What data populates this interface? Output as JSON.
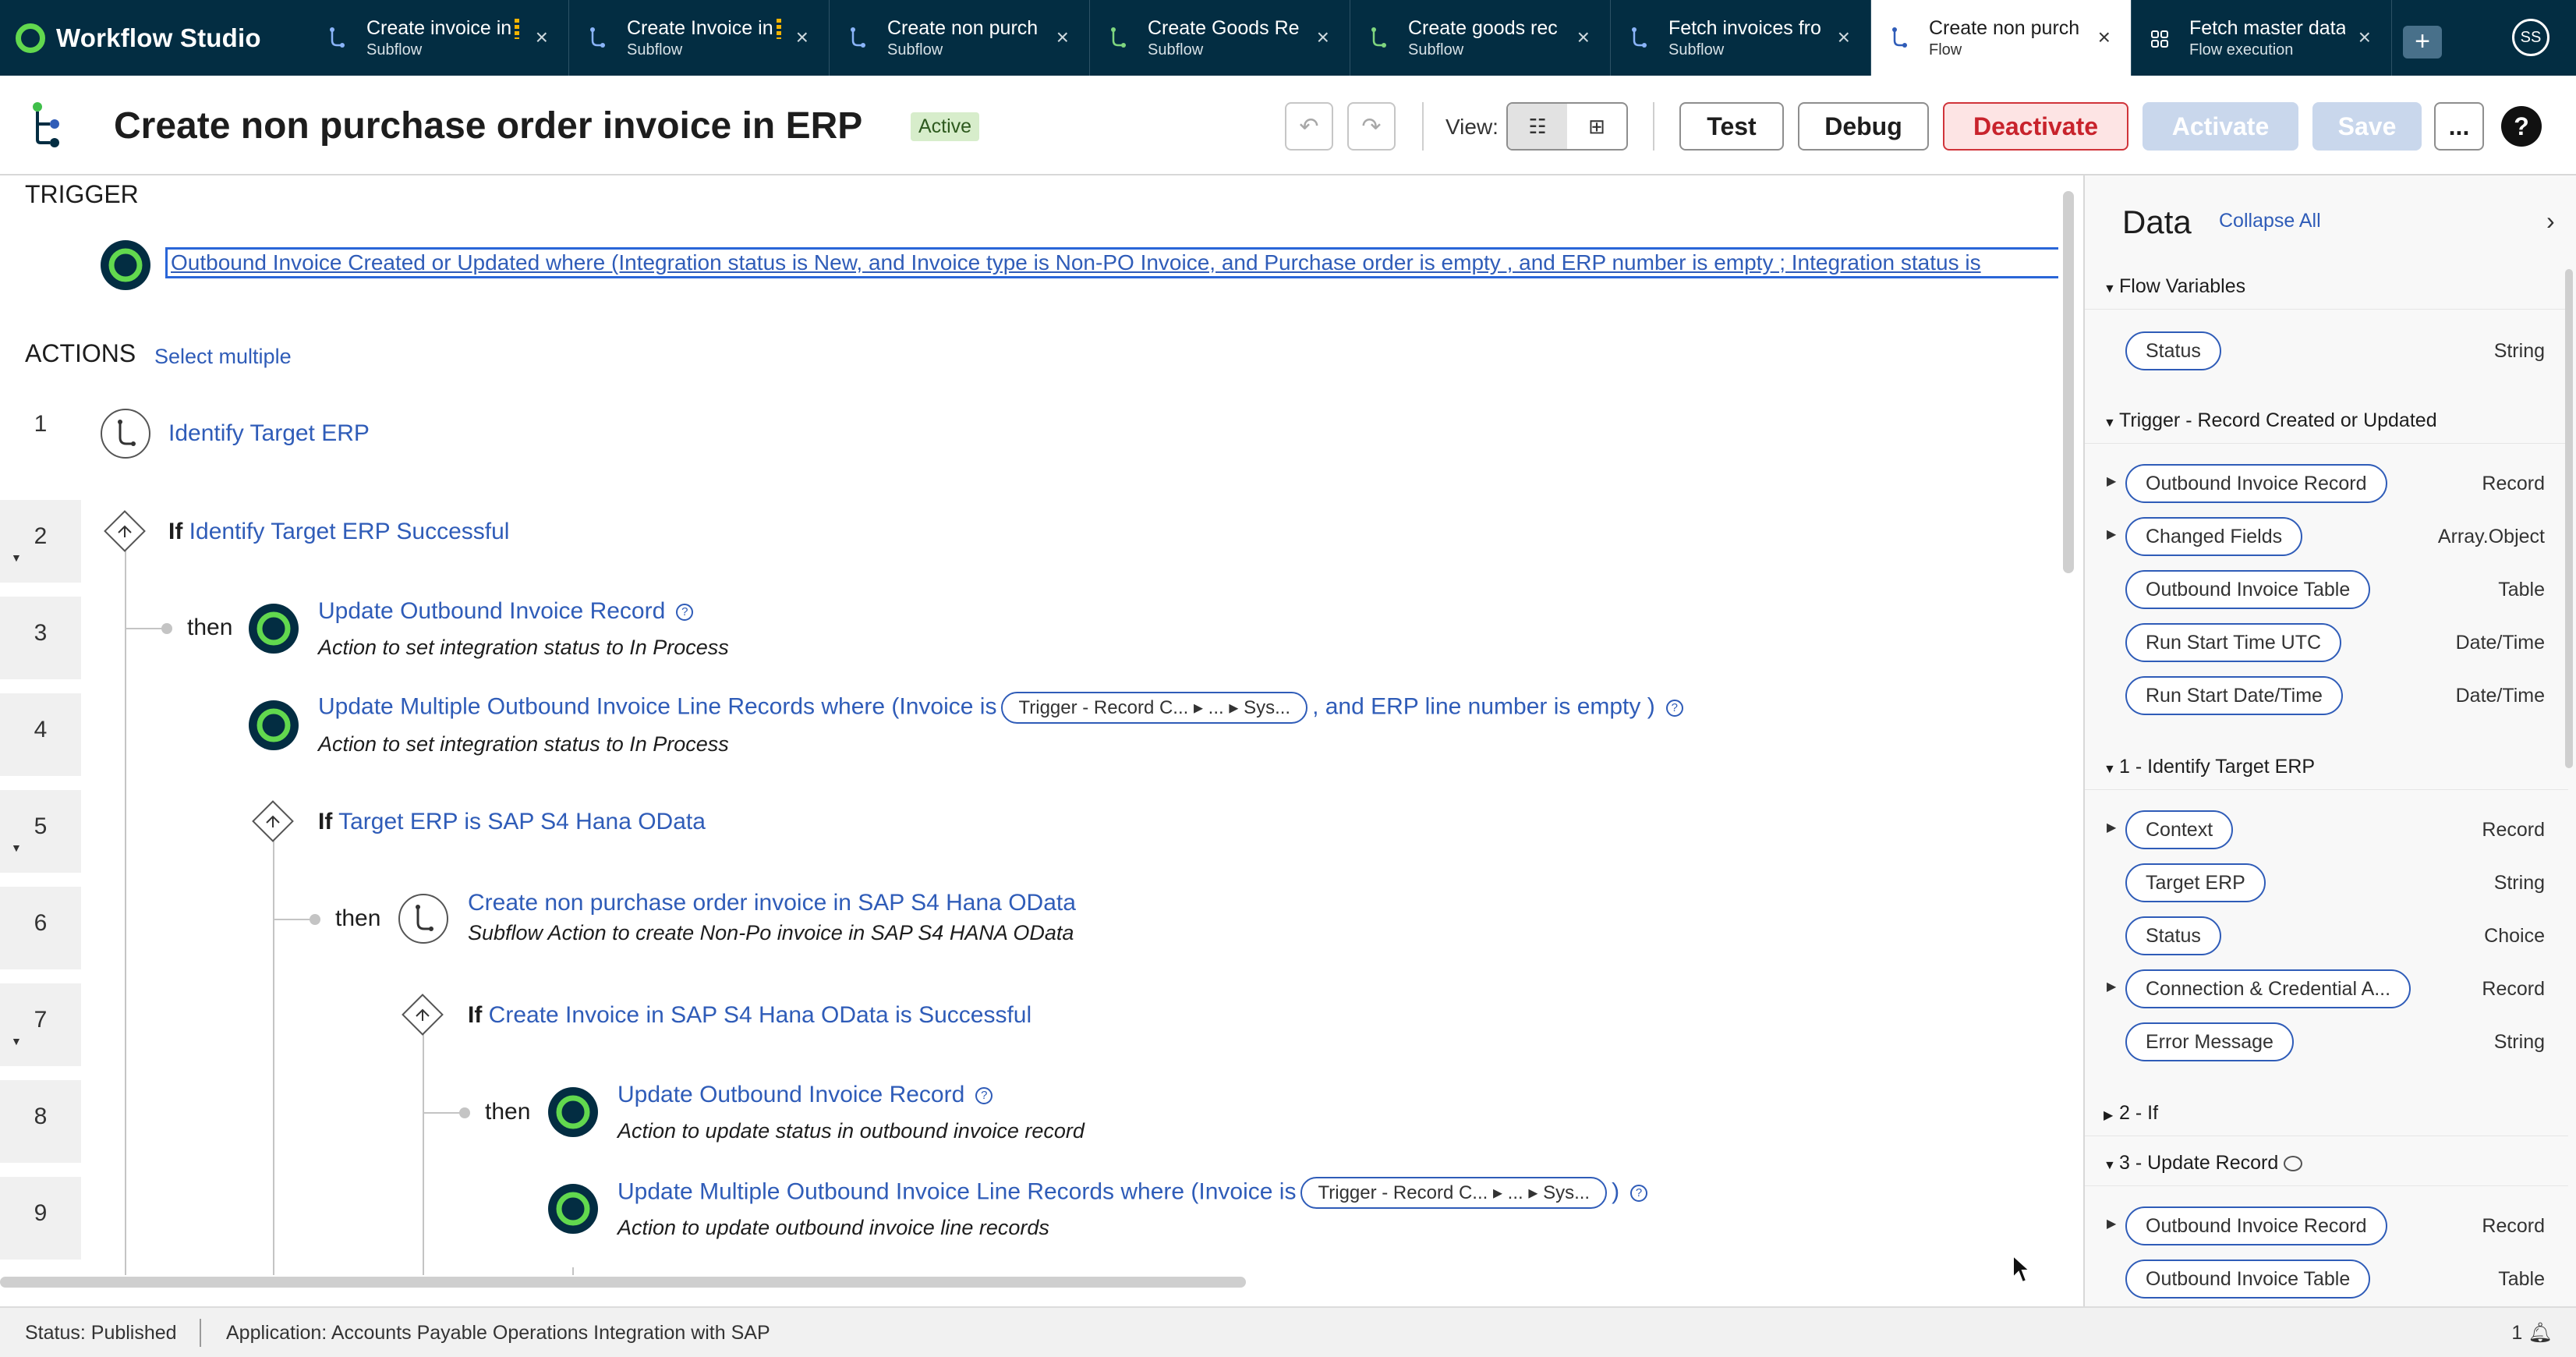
{
  "app": {
    "name": "Workflow Studio"
  },
  "tabs": [
    {
      "name": "Create invoice in",
      "sub": "Subflow",
      "warn": true
    },
    {
      "name": "Create Invoice in",
      "sub": "Subflow",
      "warn": true
    },
    {
      "name": "Create non purch",
      "sub": "Subflow",
      "warn": false
    },
    {
      "name": "Create Goods Re",
      "sub": "Subflow",
      "warn": false
    },
    {
      "name": "Create goods rec",
      "sub": "Subflow",
      "warn": false
    },
    {
      "name": "Fetch invoices fro",
      "sub": "Subflow",
      "warn": false
    },
    {
      "name": "Create non purch",
      "sub": "Flow",
      "warn": false,
      "active": true
    },
    {
      "name": "Fetch master data",
      "sub": "Flow execution",
      "warn": false
    }
  ],
  "user": {
    "initials": "SS"
  },
  "header": {
    "title": "Create non purchase order invoice in ERP",
    "status_badge": "Active",
    "view_label": "View:",
    "buttons": {
      "test": "Test",
      "debug": "Debug",
      "deactivate": "Deactivate",
      "activate": "Activate",
      "save": "Save",
      "more": "...",
      "help": "?"
    }
  },
  "trigger": {
    "section_label": "TRIGGER",
    "text": "Outbound Invoice Created or Updated where (Integration status is New, and Invoice type is Non-PO Invoice, and Purchase order is empty , and ERP number is empty ; Integration status is"
  },
  "actions": {
    "section_label": "ACTIONS",
    "select_multiple": "Select multiple",
    "then_label": "then",
    "if_label": "If",
    "rows": [
      "1",
      "2",
      "3",
      "4",
      "5",
      "6",
      "7",
      "8",
      "9"
    ],
    "steps": [
      {
        "title": "Identify Target ERP"
      },
      {
        "title": "Identify Target ERP Successful"
      },
      {
        "title": "Update Outbound Invoice Record",
        "desc": "Action to set integration status to In Process"
      },
      {
        "title": "Update Multiple Outbound Invoice Line Records where (Invoice is",
        "pill": "Trigger - Record C...  ▸ ...  ▸ Sys...",
        "title_after": ", and ERP line number is empty )",
        "desc": "Action to set integration status to In Process"
      },
      {
        "title": "Target ERP is SAP S4 Hana OData"
      },
      {
        "title": "Create non purchase order invoice in SAP S4 Hana OData",
        "desc": "Subflow Action to create Non-Po invoice in SAP S4 HANA OData"
      },
      {
        "title": "Create Invoice in SAP S4 Hana OData is Successful"
      },
      {
        "title": "Update Outbound Invoice Record",
        "desc": "Action to update status in outbound invoice record"
      },
      {
        "title": "Update Multiple Outbound Invoice Line Records where (Invoice is",
        "pill": "Trigger - Record C...  ▸ ...  ▸ Sys...",
        "title_after": ")",
        "desc": "Action to update outbound invoice line records"
      }
    ]
  },
  "data_panel": {
    "title": "Data",
    "collapse_all": "Collapse All",
    "groups": [
      {
        "label": "Flow Variables",
        "items": [
          {
            "name": "Status",
            "type": "String"
          }
        ]
      },
      {
        "label": "Trigger - Record Created or Updated",
        "items": [
          {
            "name": "Outbound Invoice Record",
            "type": "Record"
          },
          {
            "name": "Changed Fields",
            "type": "Array.Object"
          },
          {
            "name": "Outbound Invoice Table",
            "type": "Table"
          },
          {
            "name": "Run Start Time UTC",
            "type": "Date/Time"
          },
          {
            "name": "Run Start Date/Time",
            "type": "Date/Time"
          }
        ]
      },
      {
        "label": "1 - Identify Target ERP",
        "items": [
          {
            "name": "Context",
            "type": "Record"
          },
          {
            "name": "Target ERP",
            "type": "String"
          },
          {
            "name": "Status",
            "type": "Choice"
          },
          {
            "name": "Connection & Credential A...",
            "type": "Record"
          },
          {
            "name": "Error Message",
            "type": "String"
          }
        ]
      },
      {
        "label": "2 - If",
        "items": []
      },
      {
        "label": "3 - Update Record",
        "items": [
          {
            "name": "Outbound Invoice Record",
            "type": "Record"
          },
          {
            "name": "Outbound Invoice Table",
            "type": "Table"
          }
        ]
      }
    ]
  },
  "statusbar": {
    "status": "Status: Published",
    "application": "Application: Accounts Payable Operations Integration with SAP",
    "notifications": "1"
  }
}
